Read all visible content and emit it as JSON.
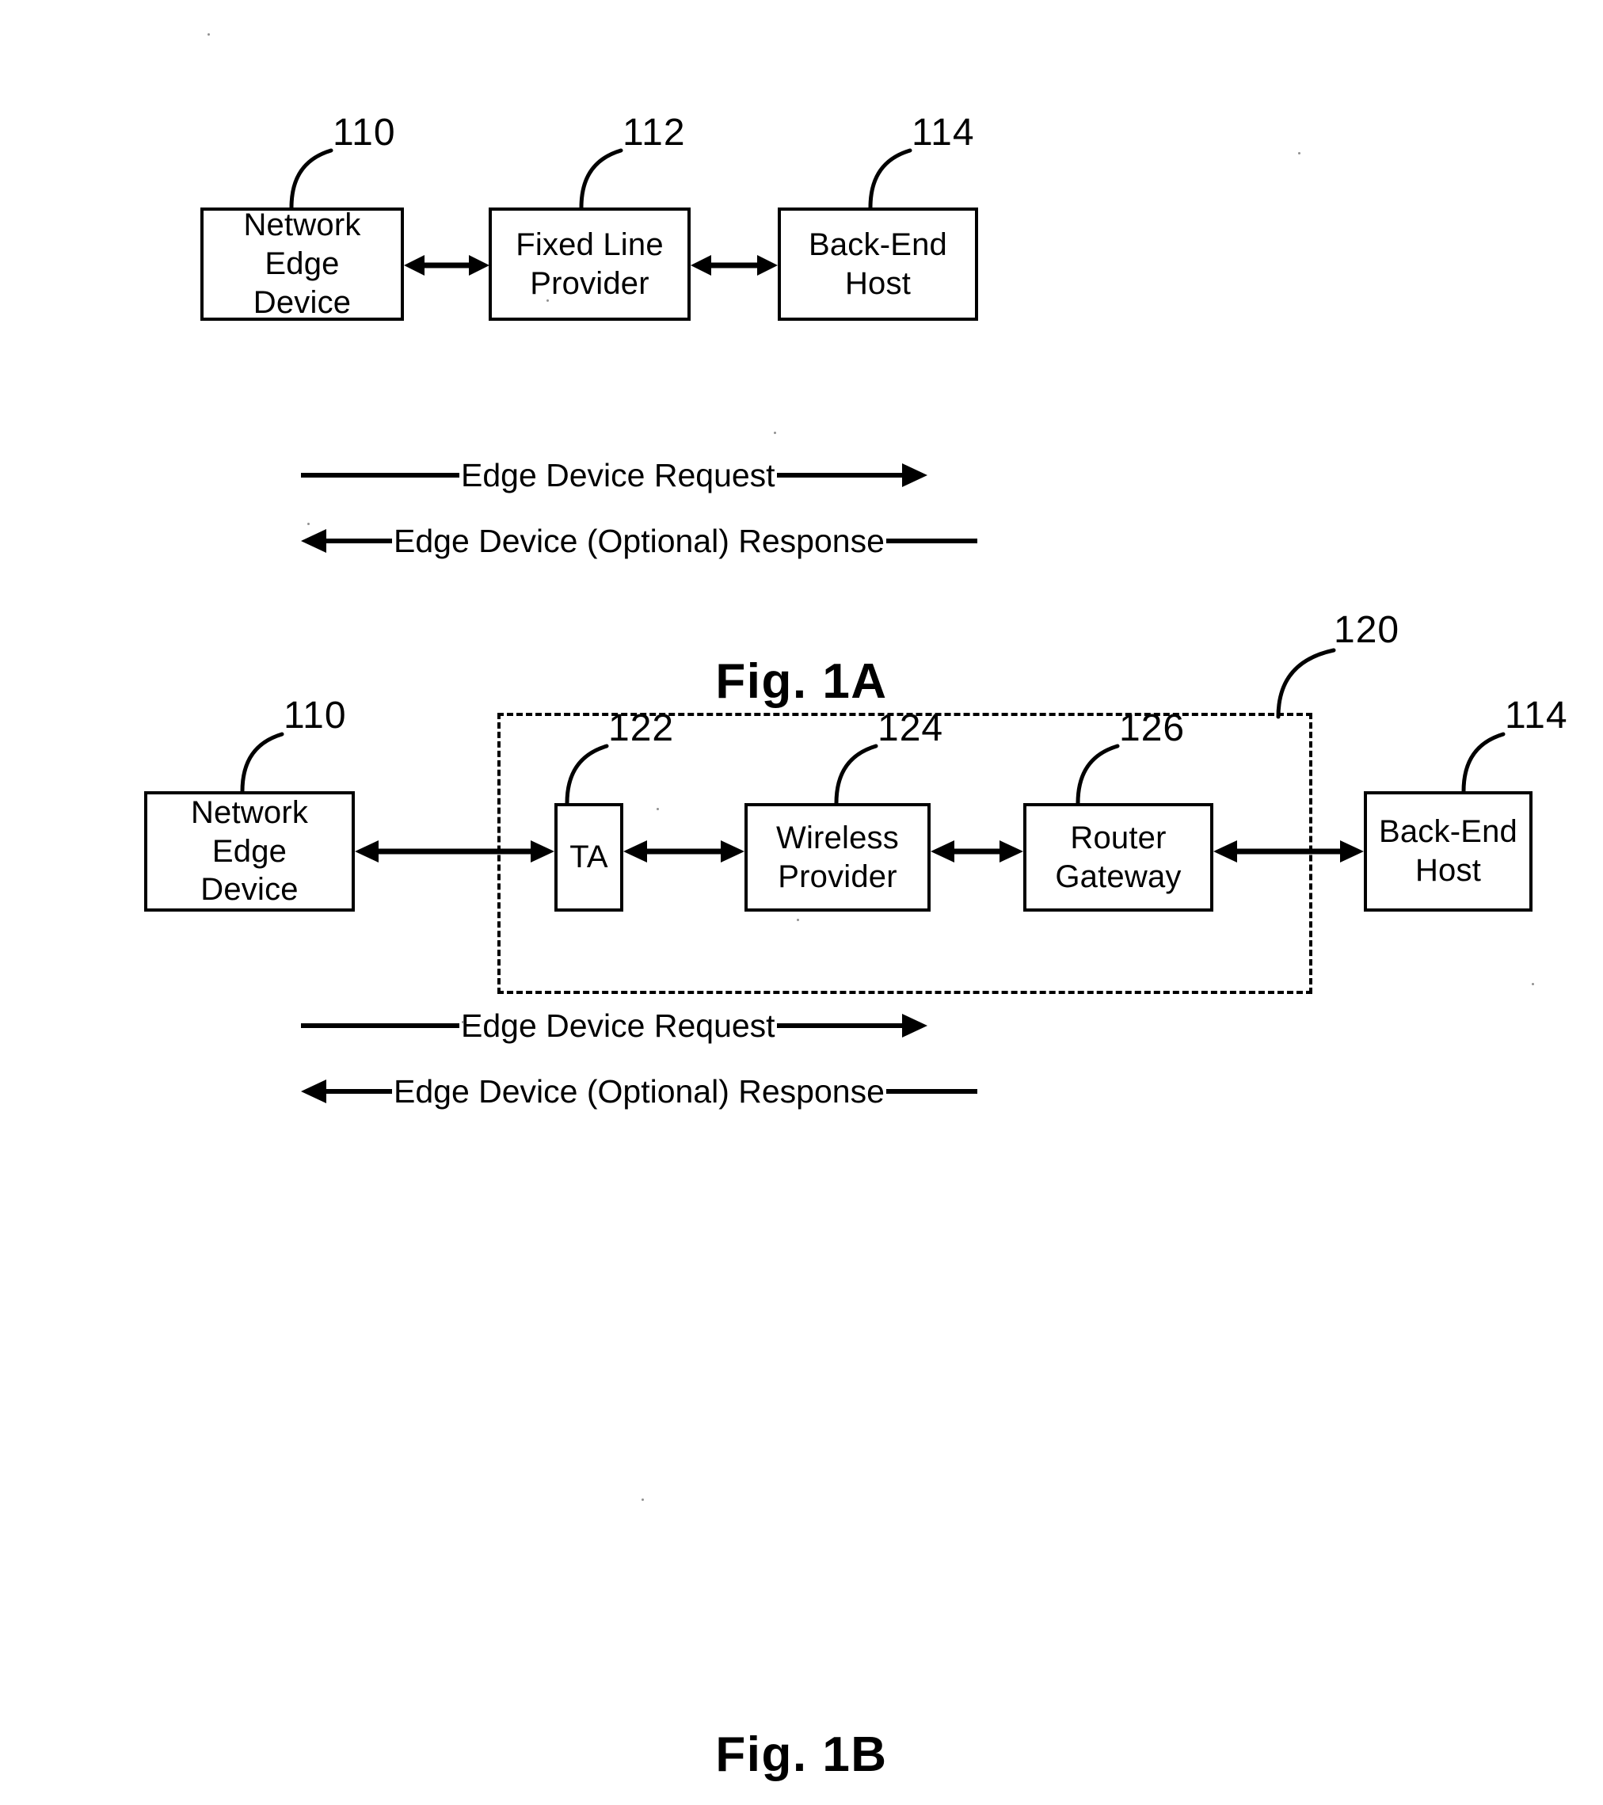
{
  "document": {
    "type": "patent-figure-sheet",
    "figures": [
      {
        "caption": "Fig. 1A",
        "nodes": [
          {
            "ref": "110",
            "label": "Network Edge\nDevice"
          },
          {
            "ref": "112",
            "label": "Fixed Line\nProvider"
          },
          {
            "ref": "114",
            "label": "Back-End\nHost"
          }
        ],
        "flows": [
          {
            "label": "Edge Device Request",
            "direction": "right"
          },
          {
            "label": "Edge Device (Optional) Response",
            "direction": "left"
          }
        ]
      },
      {
        "caption": "Fig. 1B",
        "group": {
          "ref": "120"
        },
        "nodes": [
          {
            "ref": "110",
            "label": "Network Edge\nDevice"
          },
          {
            "ref": "122",
            "label": "TA"
          },
          {
            "ref": "124",
            "label": "Wireless\nProvider"
          },
          {
            "ref": "126",
            "label": "Router\nGateway"
          },
          {
            "ref": "114",
            "label": "Back-End\nHost"
          }
        ],
        "flows": [
          {
            "label": "Edge Device Request",
            "direction": "right"
          },
          {
            "label": "Edge Device (Optional) Response",
            "direction": "left"
          }
        ]
      }
    ]
  },
  "colors": {
    "ink": "#000000",
    "paper": "#ffffff"
  }
}
